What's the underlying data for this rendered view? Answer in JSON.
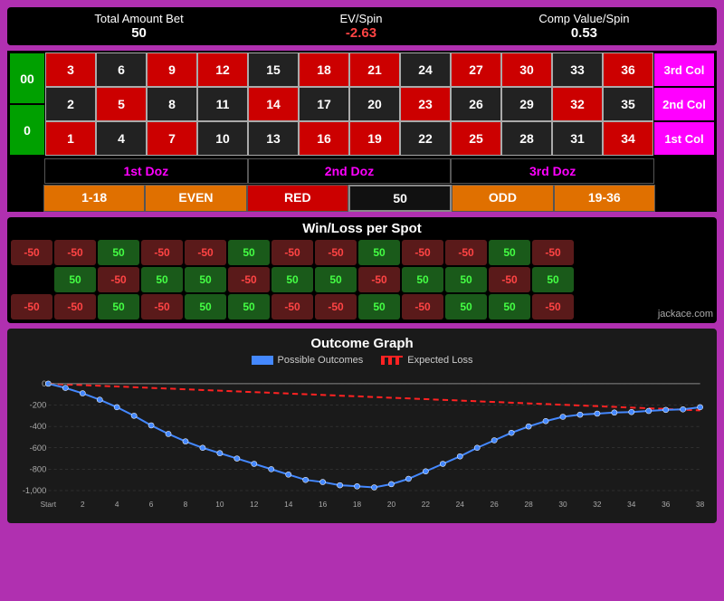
{
  "stats": {
    "total_label": "Total Amount Bet",
    "total_value": "50",
    "ev_label": "EV/Spin",
    "ev_value": "-2.63",
    "comp_label": "Comp Value/Spin",
    "comp_value": "0.53"
  },
  "table": {
    "zeros": [
      "00",
      "0"
    ],
    "rows": [
      [
        {
          "n": "3",
          "c": "red"
        },
        {
          "n": "6",
          "c": "black"
        },
        {
          "n": "9",
          "c": "red"
        },
        {
          "n": "12",
          "c": "red"
        },
        {
          "n": "15",
          "c": "black"
        },
        {
          "n": "18",
          "c": "red"
        },
        {
          "n": "21",
          "c": "red"
        },
        {
          "n": "24",
          "c": "black"
        },
        {
          "n": "27",
          "c": "red"
        },
        {
          "n": "30",
          "c": "red"
        },
        {
          "n": "33",
          "c": "black"
        },
        {
          "n": "36",
          "c": "red"
        }
      ],
      [
        {
          "n": "2",
          "c": "black"
        },
        {
          "n": "5",
          "c": "red"
        },
        {
          "n": "8",
          "c": "black"
        },
        {
          "n": "11",
          "c": "black"
        },
        {
          "n": "14",
          "c": "red"
        },
        {
          "n": "17",
          "c": "black"
        },
        {
          "n": "20",
          "c": "black"
        },
        {
          "n": "23",
          "c": "red"
        },
        {
          "n": "26",
          "c": "black"
        },
        {
          "n": "29",
          "c": "black"
        },
        {
          "n": "32",
          "c": "red"
        },
        {
          "n": "35",
          "c": "black"
        }
      ],
      [
        {
          "n": "1",
          "c": "red"
        },
        {
          "n": "4",
          "c": "black"
        },
        {
          "n": "7",
          "c": "red"
        },
        {
          "n": "10",
          "c": "black"
        },
        {
          "n": "13",
          "c": "black"
        },
        {
          "n": "16",
          "c": "red"
        },
        {
          "n": "19",
          "c": "red"
        },
        {
          "n": "22",
          "c": "black"
        },
        {
          "n": "25",
          "c": "red"
        },
        {
          "n": "28",
          "c": "black"
        },
        {
          "n": "31",
          "c": "black"
        },
        {
          "n": "34",
          "c": "red"
        }
      ]
    ],
    "col_labels": [
      "3rd Col",
      "2nd Col",
      "1st Col"
    ],
    "dozens": [
      "1st Doz",
      "2nd Doz",
      "3rd Doz"
    ],
    "outside": [
      {
        "label": "1-18",
        "style": "orange"
      },
      {
        "label": "EVEN",
        "style": "orange"
      },
      {
        "label": "RED",
        "style": "red"
      },
      {
        "label": "50",
        "style": "black"
      },
      {
        "label": "ODD",
        "style": "orange"
      },
      {
        "label": "19-36",
        "style": "orange"
      }
    ]
  },
  "winloss": {
    "title": "Win/Loss per Spot",
    "rows": [
      {
        "left": "-50",
        "cells": [
          "-50",
          "50",
          "-50",
          "-50",
          "50",
          "-50",
          "-50",
          "50",
          "-50",
          "-50",
          "50",
          "-50"
        ]
      },
      {
        "left": null,
        "cells": [
          "50",
          "-50",
          "50",
          "50",
          "-50",
          "50",
          "50",
          "-50",
          "50",
          "50",
          "-50",
          "50"
        ]
      },
      {
        "left": "-50",
        "cells": [
          "-50",
          "50",
          "-50",
          "50",
          "50",
          "-50",
          "-50",
          "50",
          "-50",
          "50",
          "50",
          "-50"
        ]
      }
    ],
    "jackace": "jackace.com"
  },
  "graph": {
    "title": "Outcome Graph",
    "legend_possible": "Possible Outcomes",
    "legend_expected": "Expected Loss",
    "x_labels": [
      "Start",
      "2",
      "4",
      "6",
      "8",
      "10",
      "12",
      "14",
      "16",
      "18",
      "20",
      "22",
      "24",
      "26",
      "28",
      "30",
      "32",
      "34",
      "36",
      "38"
    ],
    "y_labels": [
      "0",
      "-200",
      "-400",
      "-600",
      "-800",
      "-1,000"
    ],
    "curve_points": [
      [
        0,
        0
      ],
      [
        1,
        -40
      ],
      [
        2,
        -90
      ],
      [
        3,
        -150
      ],
      [
        4,
        -220
      ],
      [
        5,
        -300
      ],
      [
        6,
        -390
      ],
      [
        7,
        -470
      ],
      [
        8,
        -540
      ],
      [
        9,
        -600
      ],
      [
        10,
        -650
      ],
      [
        11,
        -700
      ],
      [
        12,
        -750
      ],
      [
        13,
        -800
      ],
      [
        14,
        -850
      ],
      [
        15,
        -900
      ],
      [
        16,
        -920
      ],
      [
        17,
        -950
      ],
      [
        18,
        -960
      ],
      [
        19,
        -970
      ],
      [
        20,
        -940
      ],
      [
        21,
        -890
      ],
      [
        22,
        -820
      ],
      [
        23,
        -750
      ],
      [
        24,
        -680
      ],
      [
        25,
        -600
      ],
      [
        26,
        -530
      ],
      [
        27,
        -460
      ],
      [
        28,
        -400
      ],
      [
        29,
        -350
      ],
      [
        30,
        -310
      ],
      [
        31,
        -290
      ],
      [
        32,
        -280
      ],
      [
        33,
        -270
      ],
      [
        34,
        -265
      ],
      [
        35,
        -255
      ],
      [
        36,
        -245
      ],
      [
        37,
        -240
      ],
      [
        38,
        -220
      ]
    ],
    "expected_points": [
      [
        0,
        0
      ],
      [
        38,
        -250
      ]
    ]
  }
}
